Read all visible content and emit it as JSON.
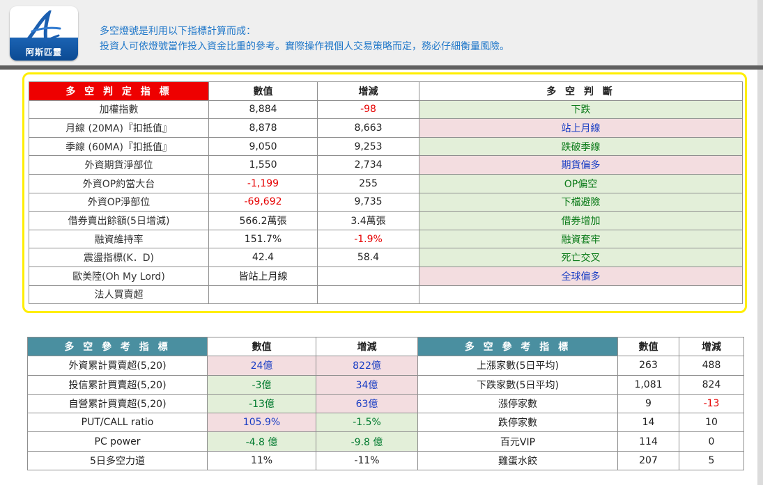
{
  "header": {
    "logo_text": "阿斯匹靈",
    "intro_line1": "多空燈號是利用以下指標計算而成：",
    "intro_line2": "投資人可依燈號當作投入資金比重的參考。實際操作視個人交易策略而定，務必仔細衡量風險。"
  },
  "table1": {
    "headers": [
      "多 空 判 定 指 標",
      "數值",
      "增減",
      "多 空 判 斷"
    ],
    "rows": [
      {
        "label": "加權指數",
        "value": "8,884",
        "change": "-98",
        "judge": "下跌"
      },
      {
        "label": "月線 (20MA)『扣抵值』",
        "value": "8,878",
        "change": "8,663",
        "judge": "站上月線"
      },
      {
        "label": "季線 (60MA)『扣抵值』",
        "value": "9,050",
        "change": "9,253",
        "judge": "跌破季線"
      },
      {
        "label": "外資期貨淨部位",
        "value": "1,550",
        "change": "2,734",
        "judge": "期貨偏多"
      },
      {
        "label": "外資OP約當大台",
        "value": "-1,199",
        "change": "255",
        "judge": "OP偏空"
      },
      {
        "label": "外資OP淨部位",
        "value": "-69,692",
        "change": "9,735",
        "judge": "下檔避險"
      },
      {
        "label": "借券賣出餘額(5日增減)",
        "value": "566.2萬張",
        "change": "3.4萬張",
        "judge": "借券增加"
      },
      {
        "label": "融資維持率",
        "value": "151.7%",
        "change": "-1.9%",
        "judge": "融資套牢"
      },
      {
        "label": "震盪指標(K．D)",
        "value": "42.4",
        "change": "58.4",
        "judge": "死亡交叉"
      },
      {
        "label": "歐美陸(Oh My Lord)",
        "value": "皆站上月線",
        "change": "",
        "judge": "全球偏多"
      },
      {
        "label": "法人買賣超",
        "value": "",
        "change": "",
        "judge": ""
      }
    ]
  },
  "table2": {
    "headers": [
      "多 空 參 考 指 標",
      "數值",
      "增減",
      "多 空 參 考 指 標",
      "數值",
      "增減"
    ],
    "rows": [
      {
        "l1": "外資累計買賣超(5,20)",
        "v1": "24億",
        "c1": "822億",
        "l2": "上漲家數(5日平均)",
        "v2": "263",
        "c2": "488"
      },
      {
        "l1": "投信累計買賣超(5,20)",
        "v1": "-3億",
        "c1": "34億",
        "l2": "下跌家數(5日平均)",
        "v2": "1,081",
        "c2": "824"
      },
      {
        "l1": "自營累計買賣超(5,20)",
        "v1": "-13億",
        "c1": "63億",
        "l2": "漲停家數",
        "v2": "9",
        "c2": "-13"
      },
      {
        "l1": "PUT/CALL ratio",
        "v1": "105.9%",
        "c1": "-1.5%",
        "l2": "跌停家數",
        "v2": "14",
        "c2": "10"
      },
      {
        "l1": "PC power",
        "v1": "-4.8 億",
        "c1": "-9.8 億",
        "l2": "百元VIP",
        "v2": "114",
        "c2": "0"
      },
      {
        "l1": "5日多空力道",
        "v1": "11%",
        "c1": "-11%",
        "l2": "雞蛋水餃",
        "v2": "207",
        "c2": "5"
      }
    ]
  },
  "colors": {
    "frame": "#ffee00",
    "header_red": "#ee0000",
    "header_teal": "#4a8fa0",
    "bull_green": "#e3efd9",
    "bear_pink": "#f3dde0",
    "negative": "#e60000",
    "blue_value": "#1a3ec4",
    "intro_text": "#1f77c9"
  }
}
